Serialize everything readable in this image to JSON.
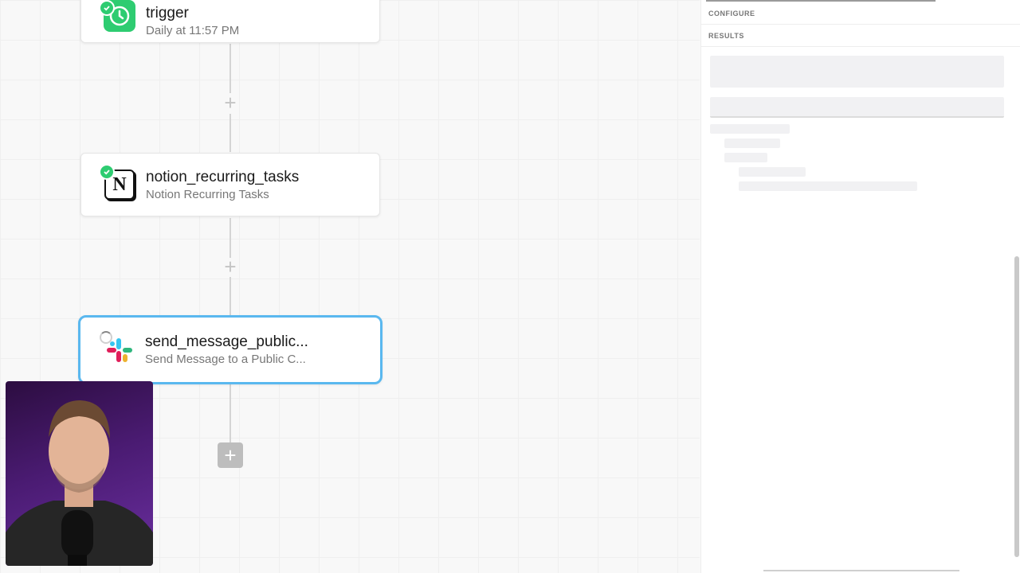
{
  "workflow": {
    "steps": [
      {
        "id": "trigger",
        "title": "trigger",
        "subtitle": "Daily at 11:57 PM",
        "icon": "clock-icon",
        "status": "success",
        "accent": "#2ecc71"
      },
      {
        "id": "notion_recurring_tasks",
        "title": "notion_recurring_tasks",
        "subtitle": "Notion Recurring Tasks",
        "icon": "notion-icon",
        "status": "success",
        "accent": "#000000"
      },
      {
        "id": "send_message_public",
        "title": "send_message_public...",
        "subtitle": "Send Message to a Public C...",
        "icon": "slack-icon",
        "status": "running",
        "selected": true,
        "accent": "#5ab8ef"
      }
    ]
  },
  "panel": {
    "tabs": [
      {
        "label": "CONFIGURE"
      },
      {
        "label": "RESULTS"
      }
    ]
  },
  "colors": {
    "selection": "#5ab8ef",
    "success": "#2ecc71"
  }
}
